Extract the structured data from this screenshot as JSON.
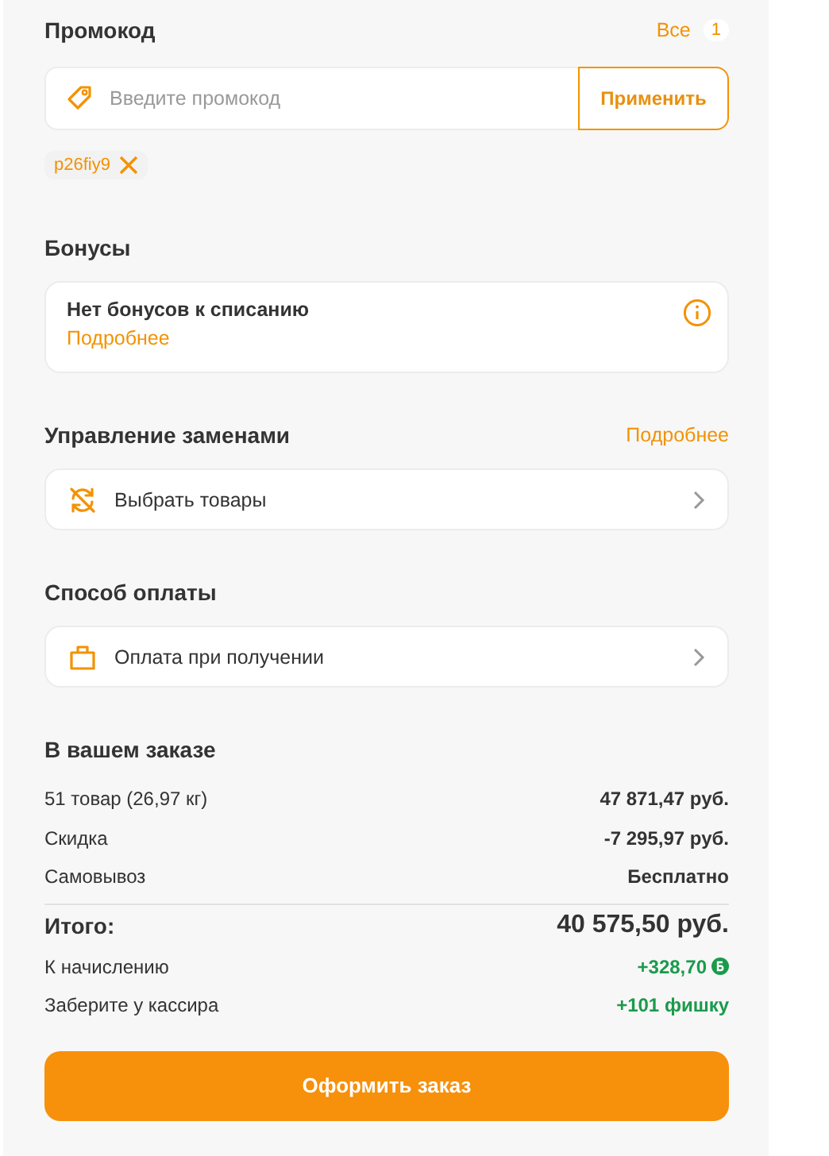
{
  "promo": {
    "title": "Промокод",
    "all_link": "Все",
    "count": "1",
    "placeholder": "Введите промокод",
    "apply": "Применить",
    "codes": [
      "p26fiy9"
    ]
  },
  "bonuses": {
    "title": "Бонусы",
    "text": "Нет бонусов к списанию",
    "link": "Подробнее"
  },
  "replacements": {
    "title": "Управление заменами",
    "link": "Подробнее",
    "action": "Выбрать товары"
  },
  "payment": {
    "title": "Способ оплаты",
    "method": "Оплата при получении"
  },
  "summary": {
    "title": "В вашем заказе",
    "rows": [
      {
        "kind": "normal",
        "label": "51 товар (26,97 кг)",
        "value": "47 871,47 руб."
      },
      {
        "kind": "normal",
        "label": "Скидка",
        "value": "-7 295,97 руб."
      },
      {
        "kind": "normal",
        "label": "Самовывоз",
        "value": "Бесплатно"
      },
      {
        "kind": "total",
        "label": "Итого:",
        "value": "40 575,50 руб."
      },
      {
        "kind": "bonus",
        "label": "К начислению",
        "value": "+328,70"
      },
      {
        "kind": "green",
        "label": "Заберите у кассира",
        "value": "+101 фишку"
      }
    ]
  },
  "checkout": "Оформить заказ"
}
